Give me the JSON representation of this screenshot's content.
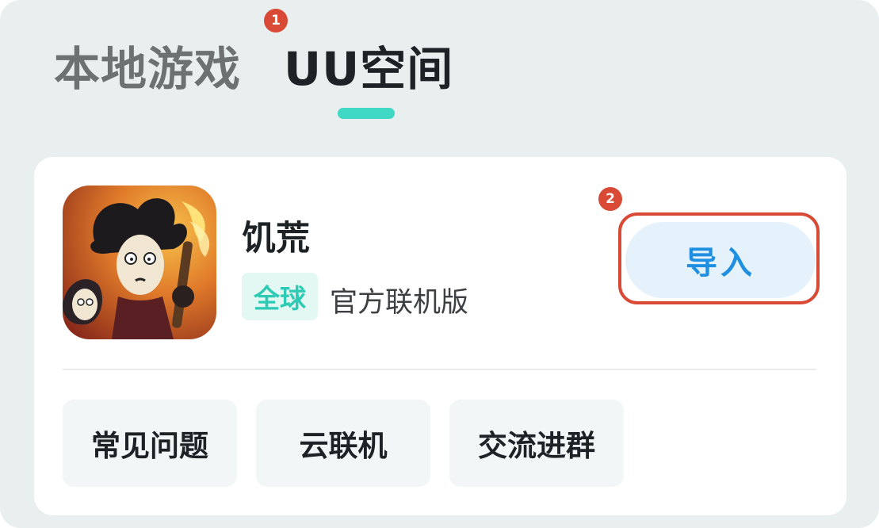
{
  "tabs": {
    "local": "本地游戏",
    "uu_space": "UU空间",
    "active": "uu_space"
  },
  "annotations": {
    "step1": "1",
    "step2": "2"
  },
  "game": {
    "name": "饥荒",
    "region_tag": "全球",
    "edition": "官方联机版",
    "import_label": "导入"
  },
  "actions": {
    "faq": "常见问题",
    "cloud_multiplayer": "云联机",
    "join_group": "交流进群"
  },
  "colors": {
    "accent": "#3ed8c4",
    "import_text": "#1f8fe1",
    "import_bg": "#e6f2fb",
    "annotation": "#d94a36"
  }
}
